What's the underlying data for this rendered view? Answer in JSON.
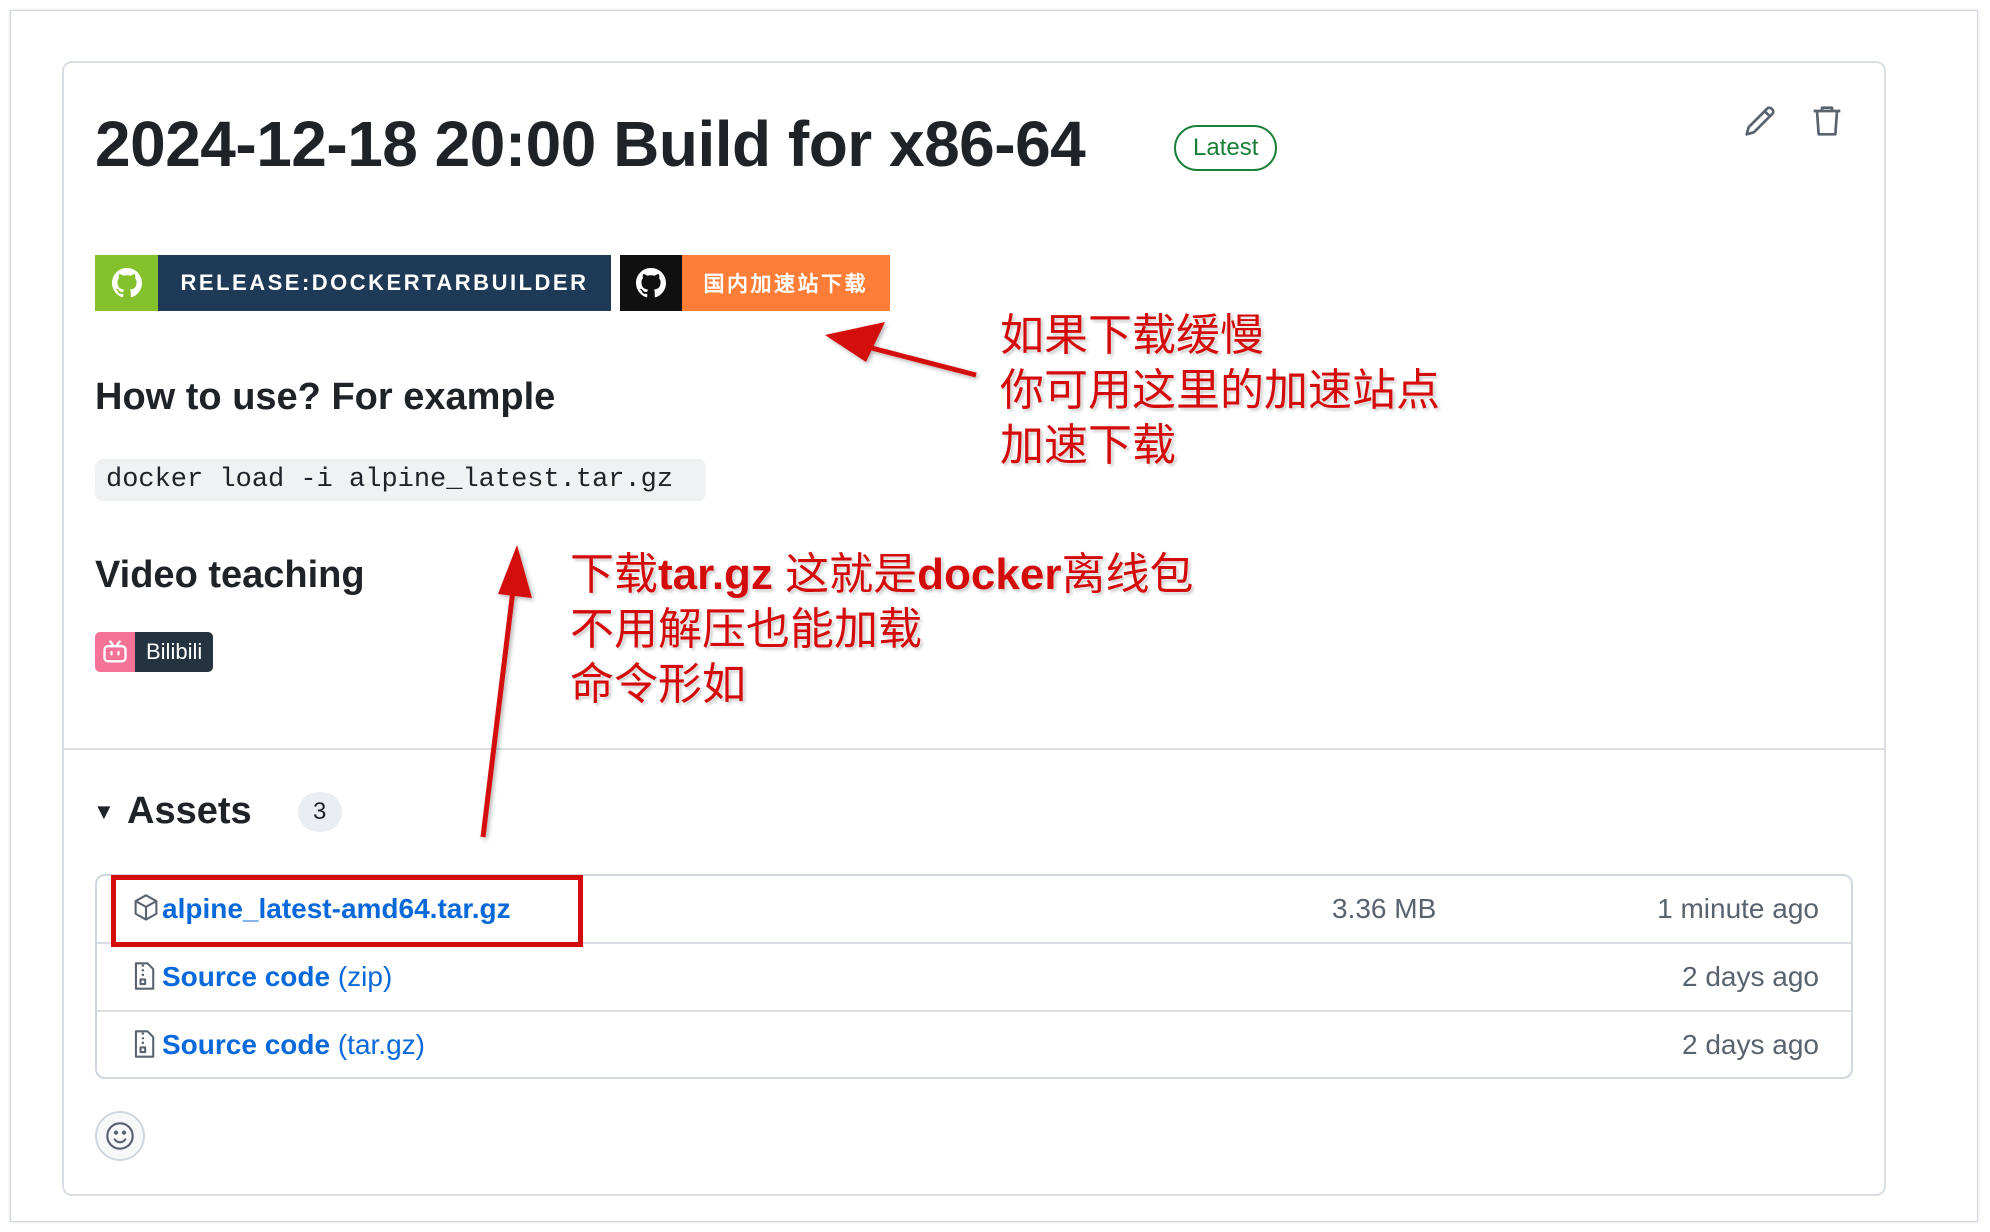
{
  "release": {
    "title": "2024-12-18 20:00 Build for x86-64",
    "latest_label": "Latest"
  },
  "actions": {
    "edit_icon": "pencil-icon",
    "delete_icon": "trash-icon"
  },
  "badges": {
    "release": {
      "text": "RELEASE:DOCKERTARBUILDER",
      "left_color": "#84c12c",
      "right_color": "#1e3a56",
      "icon": "github-icon"
    },
    "mirror": {
      "text": "国内加速站下载",
      "left_color": "#101010",
      "right_color": "#fe7d37",
      "icon": "github-icon"
    }
  },
  "body": {
    "how_to_heading": "How to use? For example",
    "command": "docker load -i alpine_latest.tar.gz",
    "video_heading": "Video teaching",
    "bilibili_label": "Bilibili"
  },
  "assets": {
    "heading": "Assets",
    "count": "3",
    "rows": [
      {
        "icon": "package-icon",
        "name": "alpine_latest-amd64.tar.gz",
        "suffix": "",
        "size": "3.36 MB",
        "time": "1 minute ago"
      },
      {
        "icon": "file-zip-icon",
        "name": "Source code",
        "suffix": " (zip)",
        "size": "",
        "time": "2 days ago"
      },
      {
        "icon": "file-zip-icon",
        "name": "Source code",
        "suffix": " (tar.gz)",
        "size": "",
        "time": "2 days ago"
      }
    ]
  },
  "annotations": {
    "note1": [
      "如果下载缓慢",
      "你可用这里的加速站点",
      "加速下载"
    ],
    "note2_line1_parts": [
      "下载",
      "tar.gz",
      " 这就是",
      "docker",
      "离线包"
    ],
    "note2_rest": [
      "不用解压也能加载",
      "命令形如"
    ],
    "color": "#d40b0b"
  },
  "reactions": {
    "icon": "smiley-icon"
  }
}
